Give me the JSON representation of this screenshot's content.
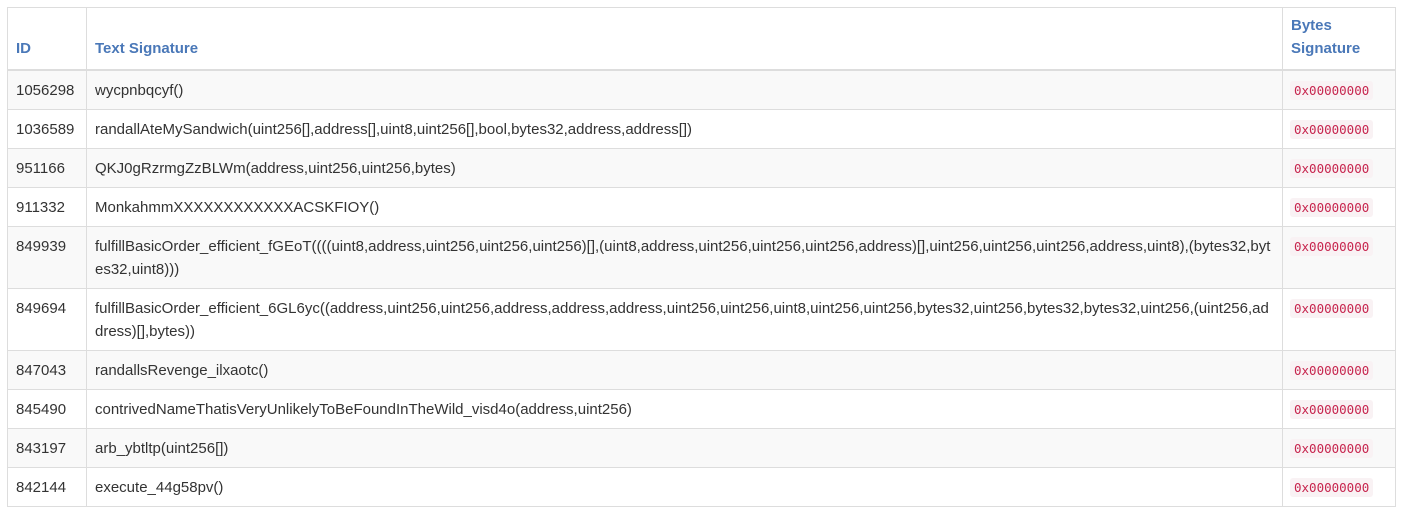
{
  "table": {
    "headers": {
      "id": "ID",
      "text_signature": "Text Signature",
      "bytes_signature": "Bytes Signature"
    },
    "rows": [
      {
        "id": "1056298",
        "text": "wycpnbqcyf()",
        "bytes": "0x00000000"
      },
      {
        "id": "1036589",
        "text": "randallAteMySandwich(uint256[],address[],uint8,uint256[],bool,bytes32,address,address[])",
        "bytes": "0x00000000"
      },
      {
        "id": "951166",
        "text": "QKJ0gRzrmgZzBLWm(address,uint256,uint256,bytes)",
        "bytes": "0x00000000"
      },
      {
        "id": "911332",
        "text": "MonkahmmXXXXXXXXXXXXACSKFIOY()",
        "bytes": "0x00000000"
      },
      {
        "id": "849939",
        "text": "fulfillBasicOrder_efficient_fGEoT((((uint8,address,uint256,uint256,uint256)[],(uint8,address,uint256,uint256,uint256,address)[],uint256,uint256,uint256,address,uint8),(bytes32,bytes32,uint8)))",
        "bytes": "0x00000000"
      },
      {
        "id": "849694",
        "text": "fulfillBasicOrder_efficient_6GL6yc((address,uint256,uint256,address,address,address,uint256,uint256,uint8,uint256,uint256,bytes32,uint256,bytes32,bytes32,uint256,(uint256,address)[],bytes))",
        "bytes": "0x00000000"
      },
      {
        "id": "847043",
        "text": "randallsRevenge_ilxaotc()",
        "bytes": "0x00000000"
      },
      {
        "id": "845490",
        "text": "contrivedNameThatisVeryUnlikelyToBeFoundInTheWild_visd4o(address,uint256)",
        "bytes": "0x00000000"
      },
      {
        "id": "843197",
        "text": "arb_ybtltp(uint256[])",
        "bytes": "0x00000000"
      },
      {
        "id": "842144",
        "text": "execute_44g58pv()",
        "bytes": "0x00000000"
      }
    ]
  },
  "colors": {
    "header_text": "#4a78b8",
    "code_text": "#c7254e",
    "code_bg": "#f9f2f4",
    "stripe": "#f9f9f9",
    "border": "#dddddd"
  }
}
